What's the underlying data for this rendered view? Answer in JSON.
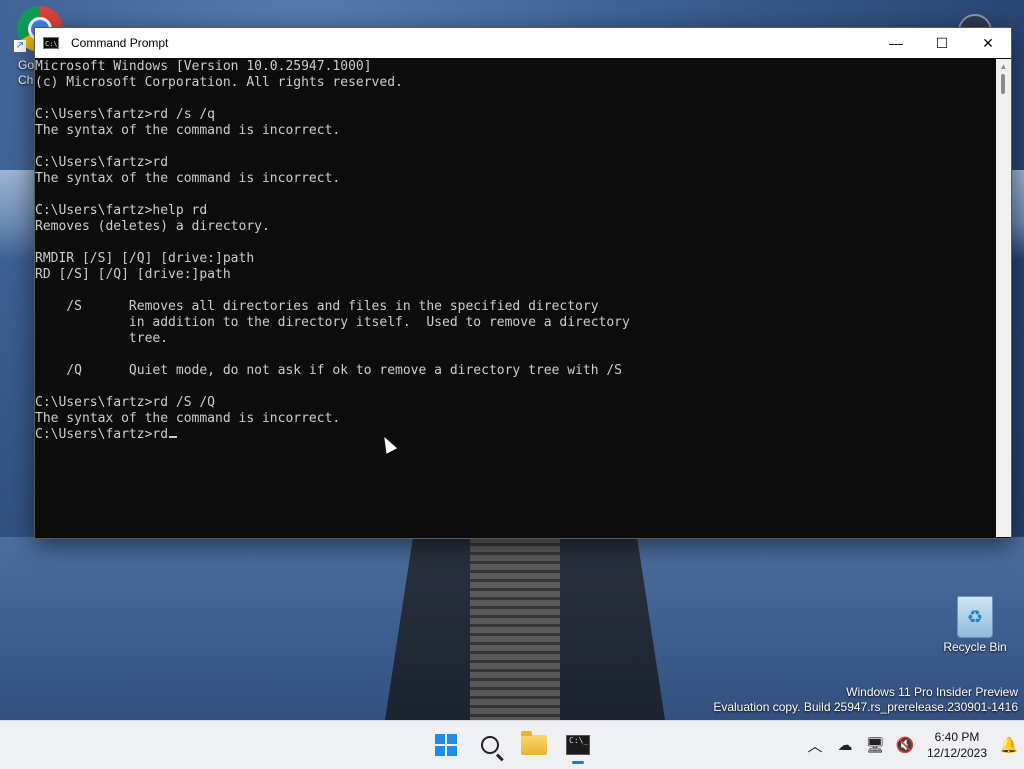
{
  "desktop": {
    "chrome_label_line1": "Go",
    "chrome_label_line2": "Ch",
    "recycle_bin_label": "Recycle Bin",
    "watermark_line1": "Windows 11 Pro Insider Preview",
    "watermark_line2": "Evaluation copy. Build 25947.rs_prerelease.230901-1416"
  },
  "window": {
    "title": "Command Prompt",
    "app_icon_text": "C:\\_",
    "minimize_glyph": "—",
    "maximize_glyph": "☐",
    "close_glyph": "✕",
    "console_lines": [
      "Microsoft Windows [Version 10.0.25947.1000]",
      "(c) Microsoft Corporation. All rights reserved.",
      "",
      "C:\\Users\\fartz>rd /s /q",
      "The syntax of the command is incorrect.",
      "",
      "C:\\Users\\fartz>rd",
      "The syntax of the command is incorrect.",
      "",
      "C:\\Users\\fartz>help rd",
      "Removes (deletes) a directory.",
      "",
      "RMDIR [/S] [/Q] [drive:]path",
      "RD [/S] [/Q] [drive:]path",
      "",
      "    /S      Removes all directories and files in the specified directory",
      "            in addition to the directory itself.  Used to remove a directory",
      "            tree.",
      "",
      "    /Q      Quiet mode, do not ask if ok to remove a directory tree with /S",
      "",
      "C:\\Users\\fartz>rd /S /Q",
      "The syntax of the command is incorrect.",
      ""
    ],
    "current_input_prompt": "C:\\Users\\fartz>rd"
  },
  "taskbar": {
    "items": [
      {
        "name": "start-button",
        "icon": "windows-logo-icon"
      },
      {
        "name": "search-button",
        "icon": "search-icon"
      },
      {
        "name": "file-explorer-button",
        "icon": "folder-icon"
      },
      {
        "name": "command-prompt-button",
        "icon": "terminal-icon",
        "active": true
      }
    ],
    "tray": {
      "overflow_glyph": "︿",
      "cloud_glyph": "☁",
      "network_glyph": "🖥",
      "volume_glyph": "🔇",
      "bell_glyph": "🔔",
      "time": "6:40 PM",
      "date": "12/12/2023"
    }
  },
  "colors": {
    "console_bg": "#0c0c0c",
    "console_fg": "#cccccc",
    "accent": "#1e78d6"
  }
}
